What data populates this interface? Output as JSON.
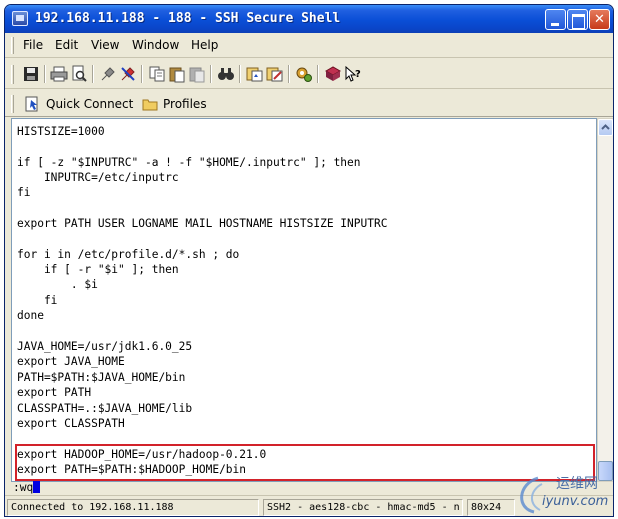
{
  "window": {
    "title": "192.168.11.188 - 188 - SSH Secure Shell"
  },
  "menu": {
    "items": [
      "File",
      "Edit",
      "View",
      "Window",
      "Help"
    ]
  },
  "toolbar": {
    "icons": [
      "save-icon",
      "print-icon",
      "print-preview-icon",
      "disconnect-icon",
      "disconnect-red-icon",
      "copy-icon",
      "paste-icon",
      "paste-disabled-icon",
      "find-icon",
      "profiles-icon",
      "profiles-edit-icon",
      "settings-icon",
      "help-topics-icon",
      "whats-this-icon"
    ]
  },
  "quickbar": {
    "quick_connect": "Quick Connect",
    "profiles": "Profiles"
  },
  "terminal": {
    "lines": [
      "HISTSIZE=1000",
      "",
      "if [ -z \"$INPUTRC\" -a ! -f \"$HOME/.inputrc\" ]; then",
      "    INPUTRC=/etc/inputrc",
      "fi",
      "",
      "export PATH USER LOGNAME MAIL HOSTNAME HISTSIZE INPUTRC",
      "",
      "for i in /etc/profile.d/*.sh ; do",
      "    if [ -r \"$i\" ]; then",
      "        . $i",
      "    fi",
      "done",
      "",
      "JAVA_HOME=/usr/jdk1.6.0_25",
      "export JAVA_HOME",
      "PATH=$PATH:$JAVA_HOME/bin",
      "export PATH",
      "CLASSPATH=.:$JAVA_HOME/lib",
      "export CLASSPATH",
      "",
      "export HADOOP_HOME=/usr/hadoop-0.21.0",
      "export PATH=$PATH:$HADOOP_HOME/bin"
    ],
    "command": ":wq",
    "highlight_color": "#d2222a"
  },
  "status": {
    "connection": "Connected to 192.168.11.188",
    "cipher": "SSH2 - aes128-cbc - hmac-md5 - n",
    "size": "80x24"
  },
  "watermark": {
    "line1": "运维网",
    "line2": "iyunv.com"
  }
}
